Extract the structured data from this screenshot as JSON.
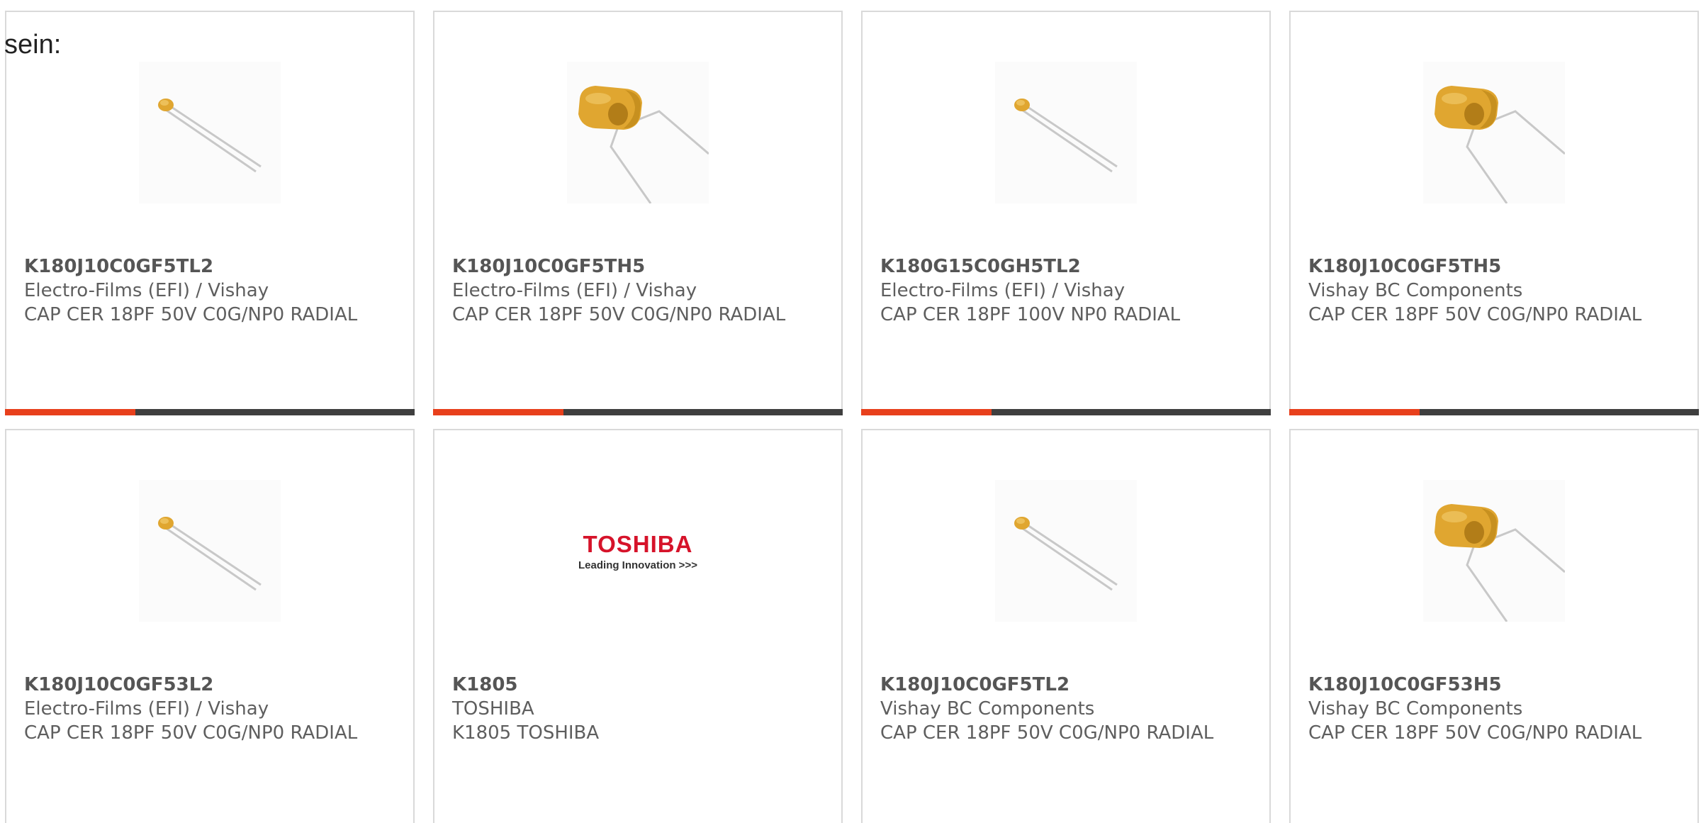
{
  "intro_text": "sein:",
  "colors": {
    "accent": "#e8401c",
    "bar": "#3f3f3f",
    "border": "#d9d9d9",
    "capacitor_body": "#e0a630",
    "lead_wire": "#c8c8c8",
    "toshiba_red": "#d6132a"
  },
  "products": [
    {
      "part_number": "K180J10C0GF5TL2",
      "manufacturer": "Electro-Films (EFI) / Vishay",
      "description": "CAP CER 18PF 50V C0G/NP0 RADIAL",
      "image": "small-radial-capacitor-icon",
      "has_bar": true
    },
    {
      "part_number": "K180J10C0GF5TH5",
      "manufacturer": "Electro-Films (EFI) / Vishay",
      "description": "CAP CER 18PF 50V C0G/NP0 RADIAL",
      "image": "large-radial-capacitor-icon",
      "has_bar": true
    },
    {
      "part_number": "K180G15C0GH5TL2",
      "manufacturer": "Electro-Films (EFI) / Vishay",
      "description": "CAP CER 18PF 100V NP0 RADIAL",
      "image": "small-radial-capacitor-icon",
      "has_bar": true
    },
    {
      "part_number": "K180J10C0GF5TH5",
      "manufacturer": "Vishay BC Components",
      "description": "CAP CER 18PF 50V C0G/NP0 RADIAL",
      "image": "large-radial-capacitor-icon",
      "has_bar": true
    },
    {
      "part_number": "K180J10C0GF53L2",
      "manufacturer": "Electro-Films (EFI) / Vishay",
      "description": "CAP CER 18PF 50V C0G/NP0 RADIAL",
      "image": "small-radial-capacitor-icon",
      "has_bar": false
    },
    {
      "part_number": "K1805",
      "manufacturer": "TOSHIBA",
      "description": "K1805 TOSHIBA",
      "image": "toshiba-logo",
      "logo_brand": "TOSHIBA",
      "logo_tagline": "Leading Innovation >>>",
      "has_bar": false
    },
    {
      "part_number": "K180J10C0GF5TL2",
      "manufacturer": "Vishay BC Components",
      "description": "CAP CER 18PF 50V C0G/NP0 RADIAL",
      "image": "small-radial-capacitor-icon",
      "has_bar": false
    },
    {
      "part_number": "K180J10C0GF53H5",
      "manufacturer": "Vishay BC Components",
      "description": "CAP CER 18PF 50V C0G/NP0 RADIAL",
      "image": "large-radial-capacitor-icon",
      "has_bar": false
    }
  ]
}
